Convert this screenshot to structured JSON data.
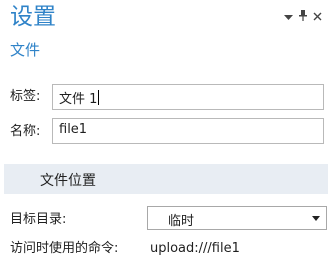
{
  "panel": {
    "title": "设置",
    "subtitle": "文件",
    "controls": {
      "dropdown_icon": "chevron-down-icon",
      "pin_icon": "pin-icon",
      "close_icon": "close-icon",
      "pin_glyph": "▼",
      "close_glyph": "×"
    }
  },
  "fields": {
    "label_label": "标签:",
    "label_value": "文件 1",
    "name_label": "名称:",
    "name_value": "file1"
  },
  "section": {
    "title": "文件位置"
  },
  "location": {
    "target_dir_label": "目标目录:",
    "target_dir_value": "临时",
    "access_cmd_label": "访问时使用的命令:",
    "access_cmd_value": "upload:///file1"
  },
  "colors": {
    "accent": "#2f83c8",
    "section_bg": "#e8edf3"
  }
}
